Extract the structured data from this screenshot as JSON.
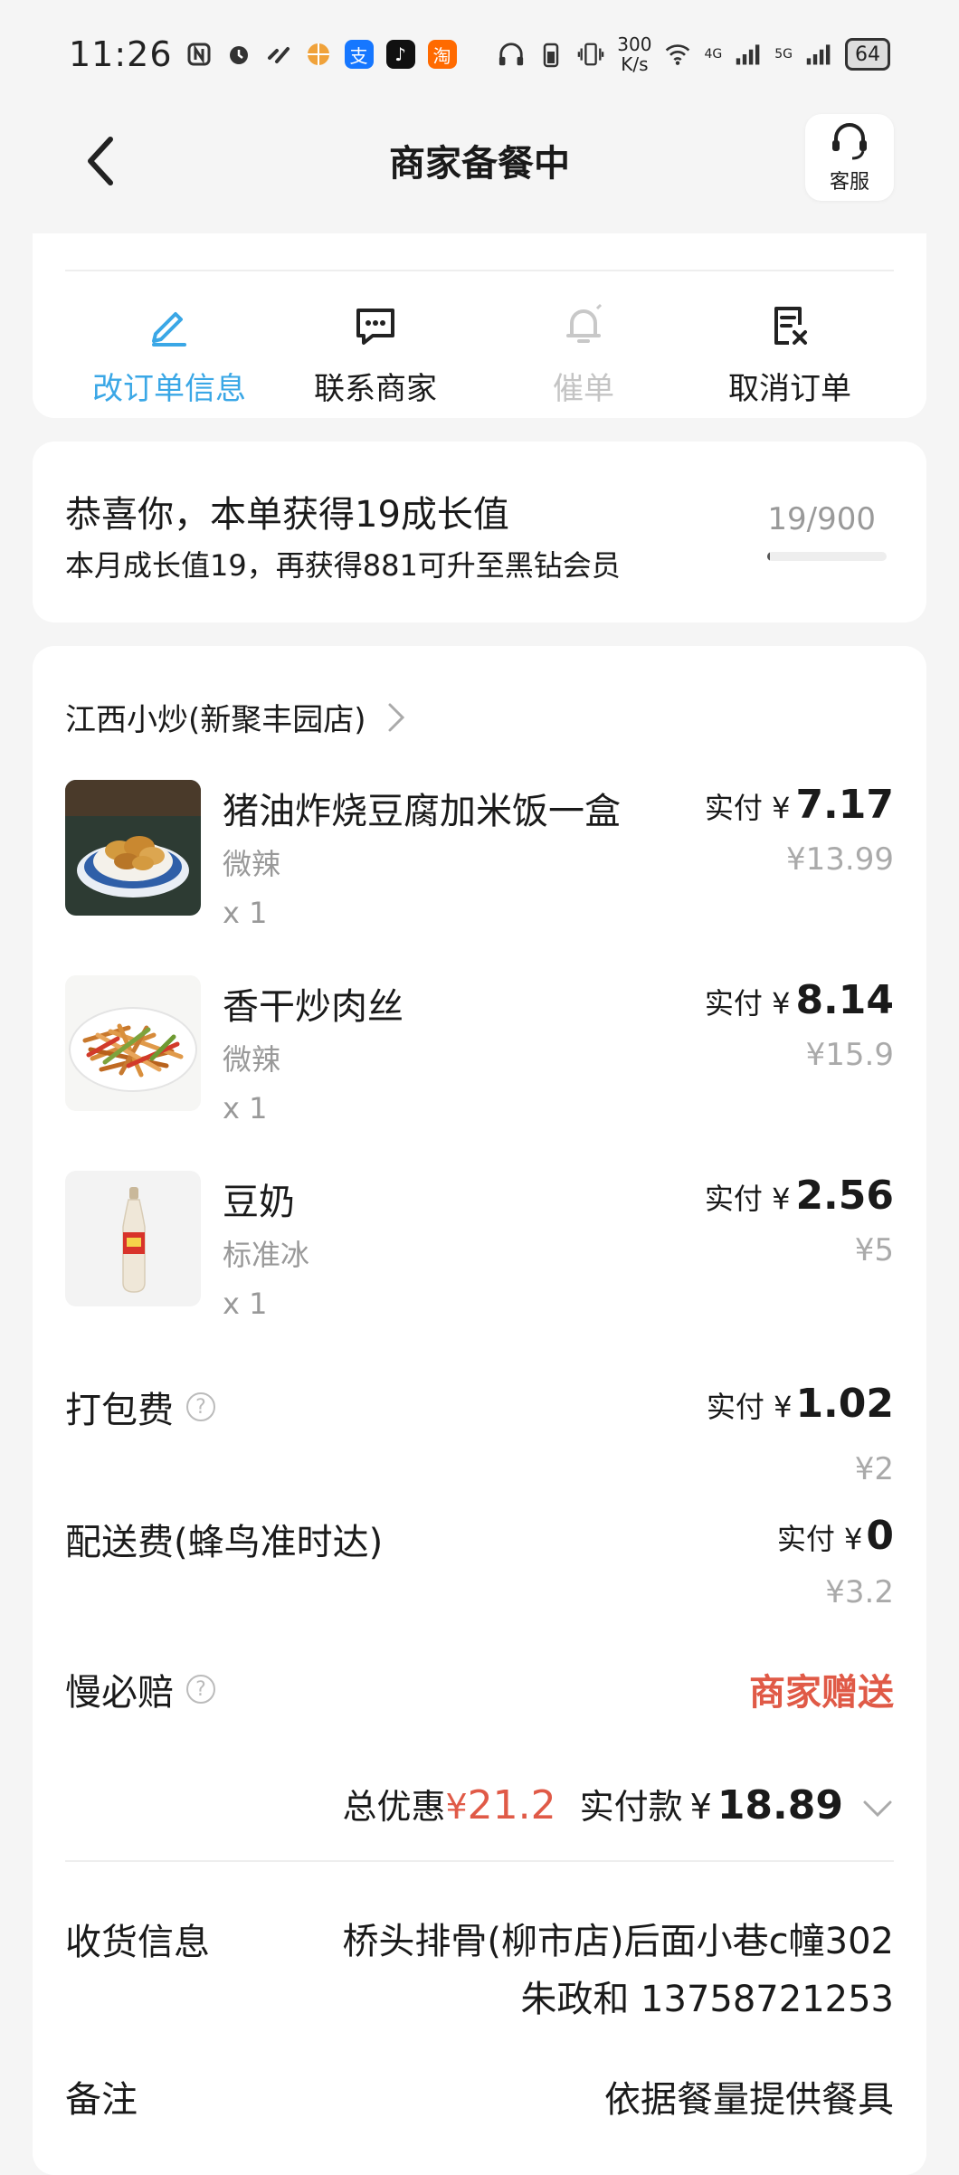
{
  "status_bar": {
    "time": "11:26",
    "app_badges": [
      {
        "glyph": "支",
        "color": "#1677ff"
      },
      {
        "glyph": "♪",
        "color": "#111111"
      },
      {
        "glyph": "淘",
        "color": "#ff6a00"
      }
    ],
    "net_speed_value": "300",
    "net_speed_unit": "K/s",
    "network_1": "4G",
    "network_2": "5G",
    "battery": "64"
  },
  "nav": {
    "title": "商家备餐中",
    "service_label": "客服"
  },
  "actions": [
    {
      "label": "改订单信息",
      "icon": "edit-icon",
      "state": "active"
    },
    {
      "label": "联系商家",
      "icon": "chat-icon",
      "state": "normal"
    },
    {
      "label": "催单",
      "icon": "bell-icon",
      "state": "disabled"
    },
    {
      "label": "取消订单",
      "icon": "cancel-order-icon",
      "state": "normal"
    }
  ],
  "growth": {
    "title": "恭喜你，本单获得19成长值",
    "subtitle": "本月成长值19，再获得881可升至黑钻会员",
    "count": "19/900",
    "progress": 0.021
  },
  "order": {
    "shop_name": "江西小炒(新聚丰园店)",
    "pay_prefix": "实付",
    "currency": "¥",
    "items": [
      {
        "name": "猪油炸烧豆腐加米饭一盒",
        "spec": "微辣",
        "qty": "x 1",
        "paid": "7.17",
        "original": "¥13.99",
        "image": "fried-tofu-image"
      },
      {
        "name": "香干炒肉丝",
        "spec": "微辣",
        "qty": "x 1",
        "paid": "8.14",
        "original": "¥15.9",
        "image": "shredded-pork-image"
      },
      {
        "name": "豆奶",
        "spec": "标准冰",
        "qty": "x 1",
        "paid": "2.56",
        "original": "¥5",
        "image": "soy-milk-image"
      }
    ],
    "packing_fee": {
      "label": "打包费",
      "paid": "1.02",
      "original": "¥2"
    },
    "delivery_fee": {
      "label": "配送费(蜂鸟准时达)",
      "paid": "0",
      "original": "¥3.2"
    },
    "late_guarantee": {
      "label": "慢必赔",
      "value": "商家赠送"
    },
    "summary": {
      "discount_label": "总优惠",
      "discount_currency": "¥",
      "discount_amount": "21.2",
      "paid_label": "实付款",
      "paid_currency": "¥",
      "paid_amount": "18.89"
    },
    "delivery_info": {
      "label": "收货信息",
      "address": "桥头排骨(柳市店)后面小巷c幢302",
      "contact": "朱政和 13758721253"
    },
    "remark": {
      "label": "备注",
      "value": "依据餐量提供餐具"
    }
  },
  "colors": {
    "accent_blue": "#3aa7e6",
    "accent_red": "#e05a47",
    "muted": "#999999"
  }
}
